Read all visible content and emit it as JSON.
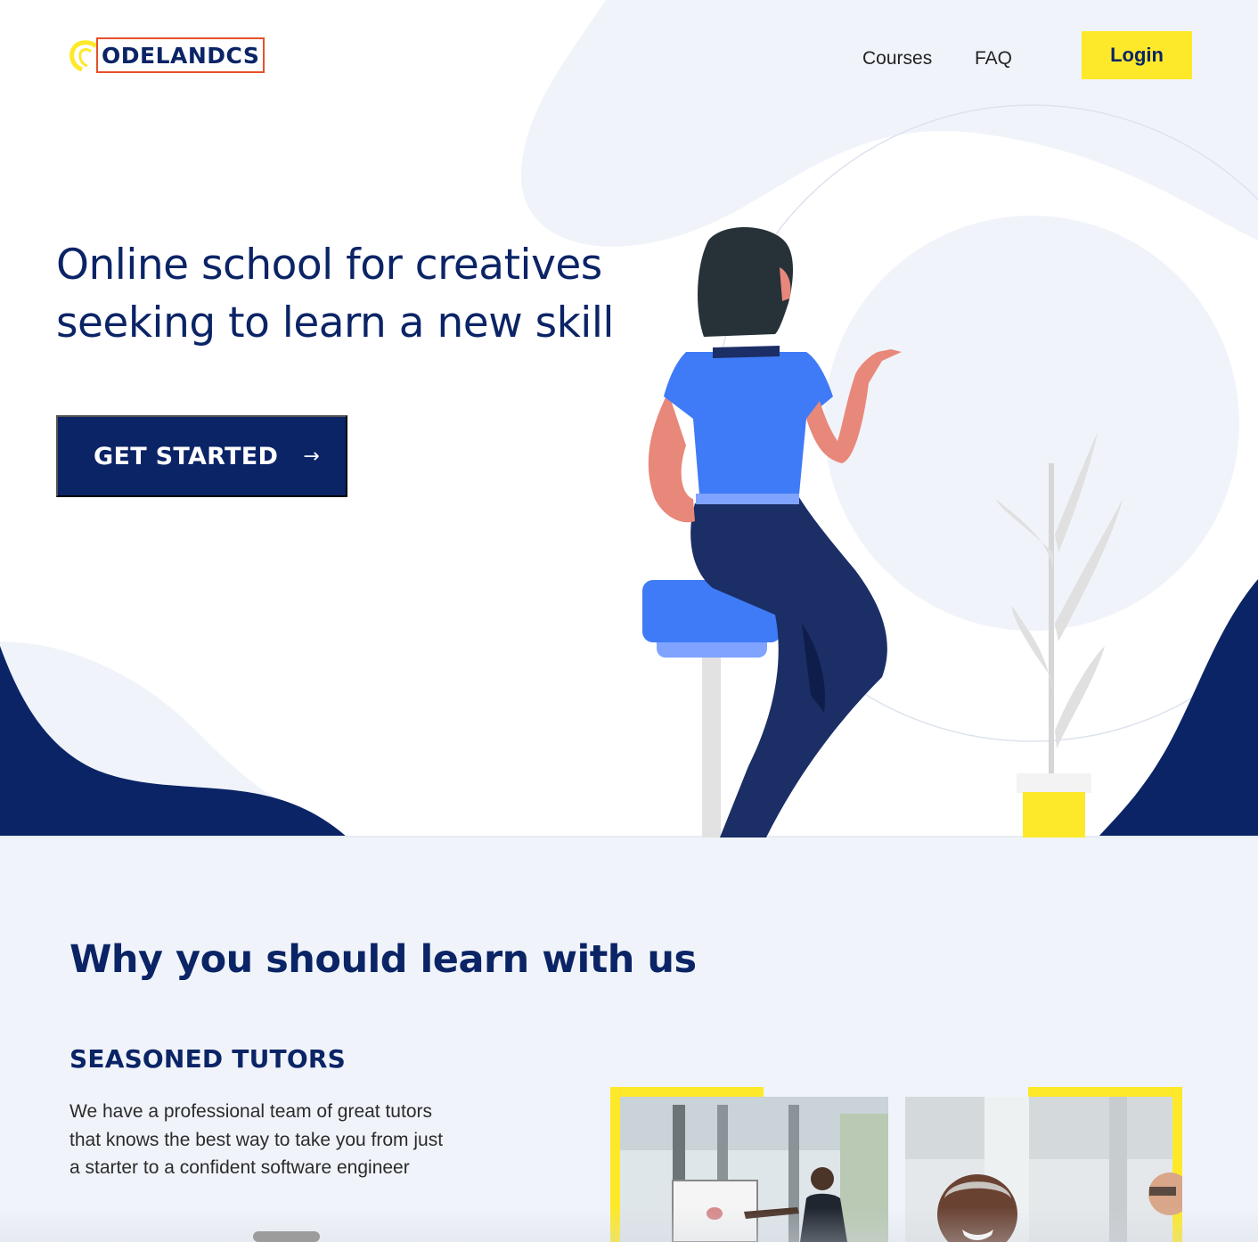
{
  "header": {
    "logo_text": "ODELANDCS",
    "nav": [
      "Courses",
      "FAQ"
    ],
    "login_label": "Login"
  },
  "hero": {
    "title_line1": "Online school for creatives",
    "title_line2": "seeking to learn a new skill",
    "cta_label": "GET STARTED",
    "cta_icon": "arrow-right-icon"
  },
  "why": {
    "title": "Why you should learn with us",
    "feature_title": "SEASONED TUTORS",
    "feature_description": "We have a professional team of great tutors that knows the best way to take you from just a starter to a confident software engineer"
  },
  "colors": {
    "navy": "#0b2466",
    "yellow": "#fde92a",
    "blue": "#3f7bf6",
    "light_bg": "#f0f4fa",
    "logo_border": "#e8502a"
  }
}
